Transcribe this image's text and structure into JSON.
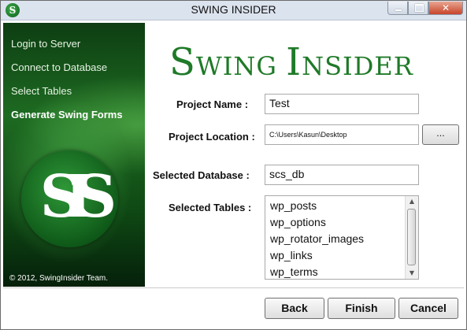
{
  "window": {
    "title": "SWING INSIDER",
    "app_icon": "swing-insider-icon",
    "controls": [
      "minimize",
      "maximize",
      "close"
    ]
  },
  "sidebar": {
    "steps": [
      {
        "label": "Login to Server",
        "active": false
      },
      {
        "label": "Connect to Database",
        "active": false
      },
      {
        "label": "Select Tables",
        "active": false
      },
      {
        "label": "Generate Swing Forms",
        "active": true
      }
    ],
    "logo_letters": "SIS",
    "copyright": "© 2012, SwingInsider Team."
  },
  "brand": {
    "title_first_initial": "S",
    "title_first_rest": "WING ",
    "title_second_initial": "I",
    "title_second_rest": "NSIDER",
    "color": "#1f7a28"
  },
  "form": {
    "project_name": {
      "label": "Project Name :",
      "value": "Test"
    },
    "project_location": {
      "label": "Project Location :",
      "value": "C:\\Users\\Kasun\\Desktop",
      "browse_label": "..."
    },
    "selected_database": {
      "label": "Selected Database :",
      "value": "scs_db"
    },
    "selected_tables": {
      "label": "Selected Tables :",
      "items": [
        "wp_posts",
        "wp_options",
        "wp_rotator_images",
        "wp_links",
        "wp_terms"
      ]
    }
  },
  "footer": {
    "back_label": "Back",
    "finish_label": "Finish",
    "cancel_label": "Cancel"
  }
}
